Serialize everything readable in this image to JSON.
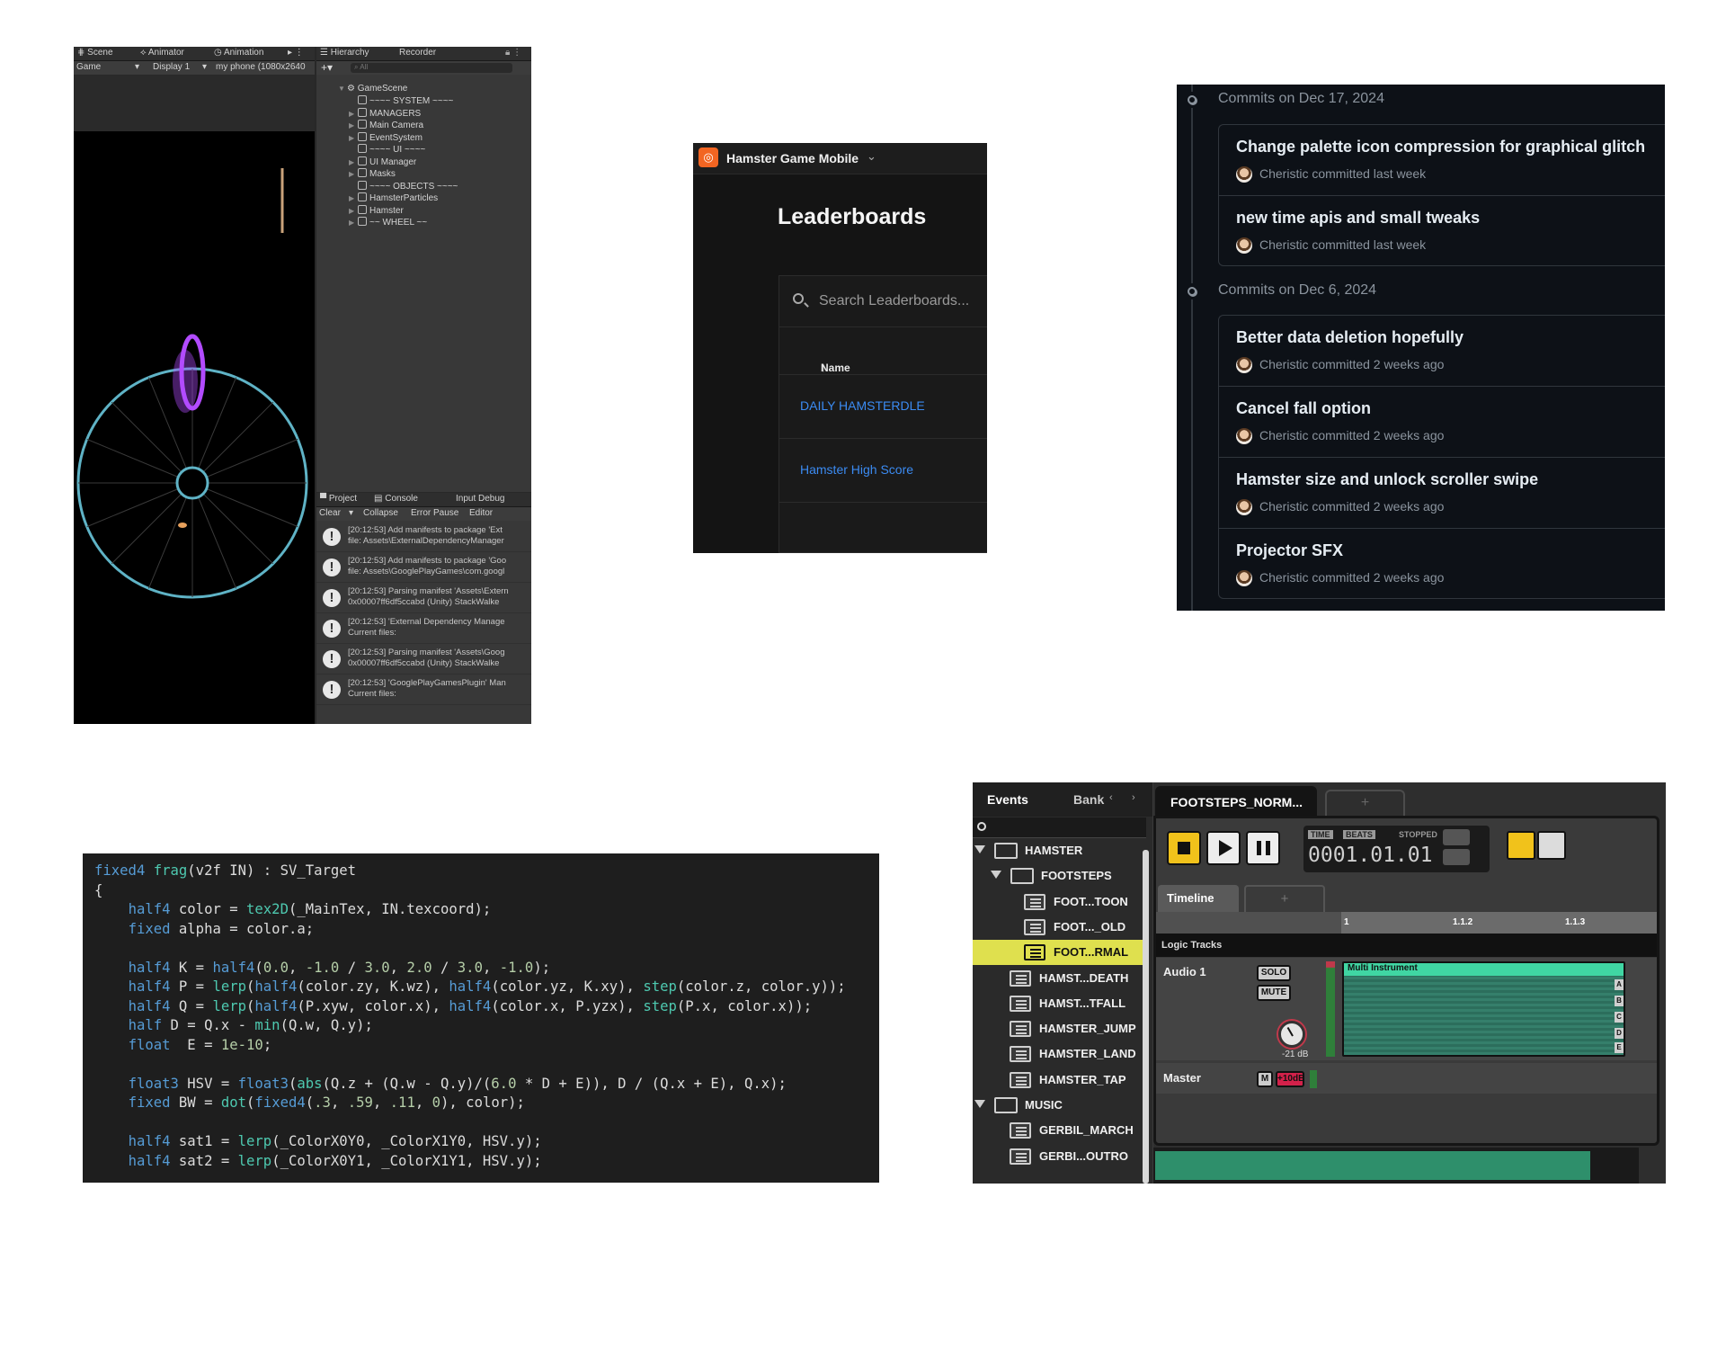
{
  "unity": {
    "tabs": {
      "scene": "Scene",
      "animator": "Animator",
      "animation": "Animation",
      "hierarchy": "Hierarchy",
      "recorder": "Recorder"
    },
    "gamebar": {
      "view": "Game",
      "display": "Display 1",
      "resolution": "my phone (1080x2640"
    },
    "hierarchy": {
      "search_placeholder": "All",
      "root": "GameScene",
      "items": [
        "~~~~ SYSTEM ~~~~",
        "MANAGERS",
        "Main Camera",
        "EventSystem",
        "~~~~ UI ~~~~",
        "UI Manager",
        "Masks",
        "~~~~ OBJECTS ~~~~",
        "HamsterParticles",
        "Hamster",
        "~~ WHEEL ~~"
      ]
    },
    "console": {
      "tabs": {
        "project": "Project",
        "console": "Console",
        "input_debug": "Input Debug"
      },
      "toolbar": {
        "clear": "Clear",
        "collapse": "Collapse",
        "error_pause": "Error Pause",
        "editor": "Editor"
      },
      "logs": [
        {
          "line1": "[20:12:53] Add manifests to package 'Ext",
          "line2": "file: Assets\\ExternalDependencyManager"
        },
        {
          "line1": "[20:12:53] Add manifests to package 'Goo",
          "line2": "file: Assets\\GooglePlayGames\\com.googl"
        },
        {
          "line1": "[20:12:53] Parsing manifest 'Assets\\Extern",
          "line2": "0x00007ff6df5ccabd (Unity) StackWalke"
        },
        {
          "line1": "[20:12:53] 'External Dependency Manage",
          "line2": "Current files:"
        },
        {
          "line1": "[20:12:53] Parsing manifest 'Assets\\Goog",
          "line2": "0x00007ff6df5ccabd (Unity) StackWalke"
        },
        {
          "line1": "[20:12:53] 'GooglePlayGamesPlugin' Man",
          "line2": "Current files:"
        }
      ]
    },
    "colors": {
      "wheel": "#5fb3c6",
      "portal": "#b24bff"
    }
  },
  "leaderboard": {
    "app_name": "Hamster Game Mobile",
    "title": "Leaderboards",
    "search_placeholder": "Search Leaderboards...",
    "column_name": "Name",
    "rows": [
      "DAILY HAMSTERDLE",
      "Hamster High Score"
    ],
    "colors": {
      "brand": "#f26522",
      "link": "#3b8bf2"
    }
  },
  "github": {
    "groups": [
      {
        "date": "Commits on Dec 17, 2024",
        "commits": [
          {
            "message": "Change palette icon compression for graphical glitch",
            "meta": "Cheristic committed last week"
          },
          {
            "message": "new time apis and small tweaks",
            "meta": "Cheristic committed last week"
          }
        ]
      },
      {
        "date": "Commits on Dec 6, 2024",
        "commits": [
          {
            "message": "Better data deletion hopefully",
            "meta": "Cheristic committed 2 weeks ago"
          },
          {
            "message": "Cancel fall option",
            "meta": "Cheristic committed 2 weeks ago"
          },
          {
            "message": "Hamster size and unlock scroller swipe",
            "meta": "Cheristic committed 2 weeks ago"
          },
          {
            "message": "Projector SFX",
            "meta": "Cheristic committed 2 weeks ago"
          }
        ]
      }
    ]
  },
  "code": {
    "lines": [
      "fixed4 frag(v2f IN) : SV_Target",
      "{",
      "    half4 color = tex2D(_MainTex, IN.texcoord);",
      "    fixed alpha = color.a;",
      "",
      "    half4 K = half4(0.0, -1.0 / 3.0, 2.0 / 3.0, -1.0);",
      "    half4 P = lerp(half4(color.zy, K.wz), half4(color.yz, K.xy), step(color.z, color.y));",
      "    half4 Q = lerp(half4(P.xyw, color.x), half4(color.x, P.yzx), step(P.x, color.x));",
      "    half D = Q.x - min(Q.w, Q.y);",
      "    float  E = 1e-10;",
      "",
      "    float3 HSV = float3(abs(Q.z + (Q.w - Q.y)/(6.0 * D + E)), D / (Q.x + E), Q.x);",
      "    fixed BW = dot(fixed4(.3, .59, .11, 0), color);",
      "",
      "    half4 sat1 = lerp(_ColorX0Y0, _ColorX1Y0, HSV.y);",
      "    half4 sat2 = lerp(_ColorX0Y1, _ColorX1Y1, HSV.y);"
    ]
  },
  "fmod": {
    "left_tabs": {
      "events": "Events",
      "banks": "Bank"
    },
    "tree": [
      {
        "label": "HAMSTER",
        "kind": "folder",
        "depth": 0,
        "selected": false
      },
      {
        "label": "FOOTSTEPS",
        "kind": "folder",
        "depth": 1,
        "selected": false
      },
      {
        "label": "FOOT...TOON",
        "kind": "event",
        "depth": 2,
        "selected": false
      },
      {
        "label": "FOOT..._OLD",
        "kind": "event",
        "depth": 2,
        "selected": false
      },
      {
        "label": "FOOT...RMAL",
        "kind": "event",
        "depth": 2,
        "selected": true
      },
      {
        "label": "HAMST...DEATH",
        "kind": "event",
        "depth": 1,
        "selected": false
      },
      {
        "label": "HAMST...TFALL",
        "kind": "event",
        "depth": 1,
        "selected": false
      },
      {
        "label": "HAMSTER_JUMP",
        "kind": "event",
        "depth": 1,
        "selected": false
      },
      {
        "label": "HAMSTER_LAND",
        "kind": "event",
        "depth": 1,
        "selected": false
      },
      {
        "label": "HAMSTER_TAP",
        "kind": "event",
        "depth": 1,
        "selected": false
      },
      {
        "label": "MUSIC",
        "kind": "folder",
        "depth": 0,
        "selected": false
      },
      {
        "label": "GERBIL_MARCH",
        "kind": "event",
        "depth": 1,
        "selected": false
      },
      {
        "label": "GERBI...OUTRO",
        "kind": "event",
        "depth": 1,
        "selected": false
      }
    ],
    "event_tab": "FOOTSTEPS_NORM...",
    "plus": "+",
    "transport": {
      "time_label": "TIME",
      "beats_label": "BEATS",
      "state": "STOPPED",
      "position": "0001.01.01"
    },
    "timeline_tab": "Timeline",
    "ruler": [
      "1",
      "1.1.2",
      "1.1.3"
    ],
    "logic_tracks": "Logic Tracks",
    "audio_track": {
      "name": "Audio 1",
      "solo": "SOLO",
      "mute": "MUTE",
      "volume": "-21 dB",
      "instrument": "Multi Instrument",
      "lanes": [
        "A",
        "B",
        "C",
        "D",
        "E"
      ]
    },
    "master": {
      "name": "Master",
      "m": "M",
      "level": "+10dB"
    },
    "colors": {
      "selected": "#dfe04e",
      "region": "#40d6a3",
      "stop": "#f1c21b"
    }
  }
}
